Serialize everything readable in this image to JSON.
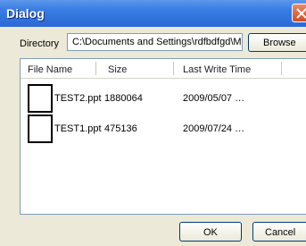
{
  "window": {
    "title": "Dialog"
  },
  "directory": {
    "label": "Directory",
    "value": "C:\\Documents and Settings\\rdfbdfgd\\M"
  },
  "buttons": {
    "browse": "Browse",
    "ok": "OK",
    "cancel": "Cancel"
  },
  "list": {
    "columns": [
      "File Name",
      "Size",
      "Last Write Time"
    ],
    "rows": [
      {
        "name": "TEST2.ppt",
        "size": "1880064",
        "time": "2009/05/07  …"
      },
      {
        "name": "TEST1.ppt",
        "size": "475136",
        "time": "2009/07/24  …"
      }
    ]
  },
  "icons": {
    "close": "close-icon",
    "file": "file-icon"
  }
}
